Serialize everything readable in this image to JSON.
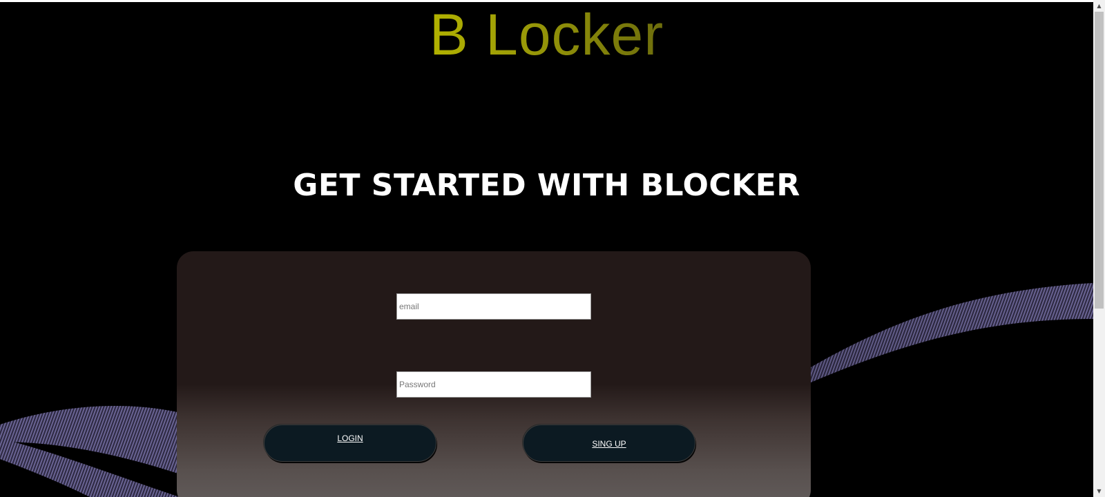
{
  "app": {
    "logo_text": "B Locker",
    "headline": "GET STARTED WITH BLOCKER"
  },
  "form": {
    "email": {
      "placeholder": "email",
      "value": ""
    },
    "password": {
      "placeholder": "Password",
      "value": ""
    },
    "login_label": "LOGIN",
    "signup_label": "SING UP"
  },
  "colors": {
    "background": "#000000",
    "logo_gradient_start": "#b2b200",
    "logo_gradient_end": "#6d6d0c",
    "card_top": "#231918",
    "card_bottom": "#625c5b",
    "button": "#0c1a22",
    "wave": "#5a5480"
  },
  "icons": {
    "scroll_up": "scroll-up-arrow-icon",
    "scroll_down": "scroll-down-arrow-icon"
  }
}
